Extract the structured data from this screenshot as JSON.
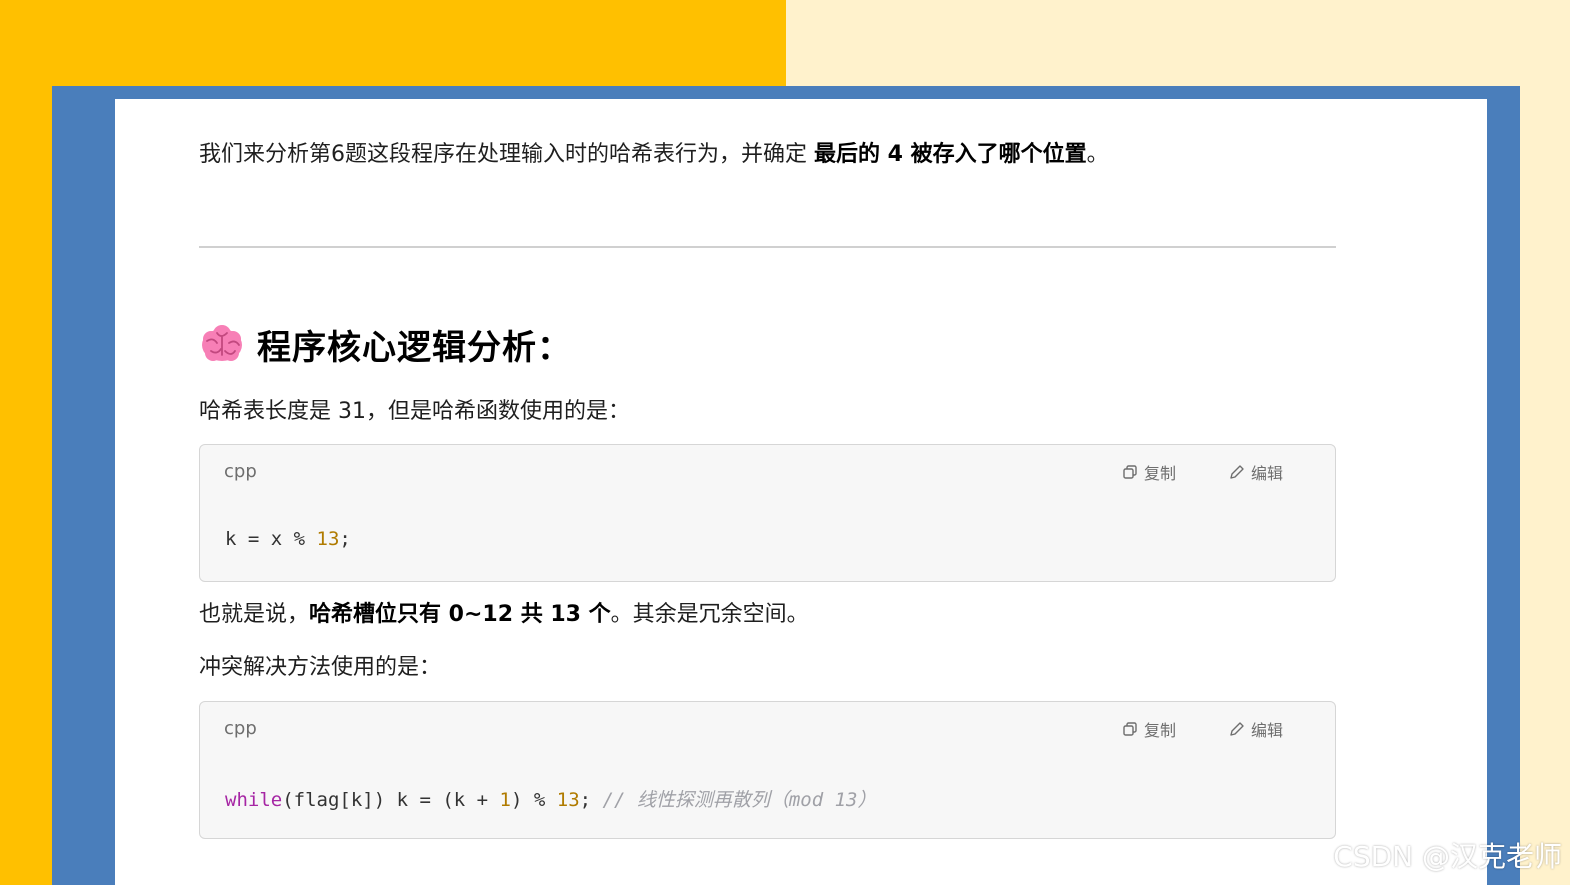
{
  "intro": {
    "prefix": "我们来分析第6题这段程序在处理输入时的哈希表行为，并确定 ",
    "bold": "最后的 4 被存入了哪个位置",
    "suffix": "。"
  },
  "heading": {
    "icon": "brain-icon",
    "text": "程序核心逻辑分析："
  },
  "para1": "哈希表长度是 31，但是哈希函数使用的是：",
  "code1": {
    "lang": "cpp",
    "copy_label": "复制",
    "edit_label": "编辑",
    "tokens": {
      "t1": "k = x % ",
      "n1": "13",
      "t2": ";"
    }
  },
  "para2": {
    "prefix": "也就是说，",
    "bold": "哈希槽位只有 0~12 共 13 个",
    "suffix": "。其余是冗余空间。"
  },
  "para3": "冲突解决方法使用的是：",
  "code2": {
    "lang": "cpp",
    "copy_label": "复制",
    "edit_label": "编辑",
    "tokens": {
      "kw": "while",
      "t1": "(flag[k]) k = (k + ",
      "n1": "1",
      "t2": ") % ",
      "n2": "13",
      "t3": "; ",
      "comment": "// 线性探测再散列（mod 13）"
    }
  },
  "watermark": "CSDN @汉克老师",
  "colors": {
    "bg_left": "#ffc000",
    "bg_right": "#fff2cc",
    "frame": "#4a7ebb",
    "keyword": "#a626a4",
    "number": "#b07b00",
    "comment": "#a0a1a7"
  }
}
